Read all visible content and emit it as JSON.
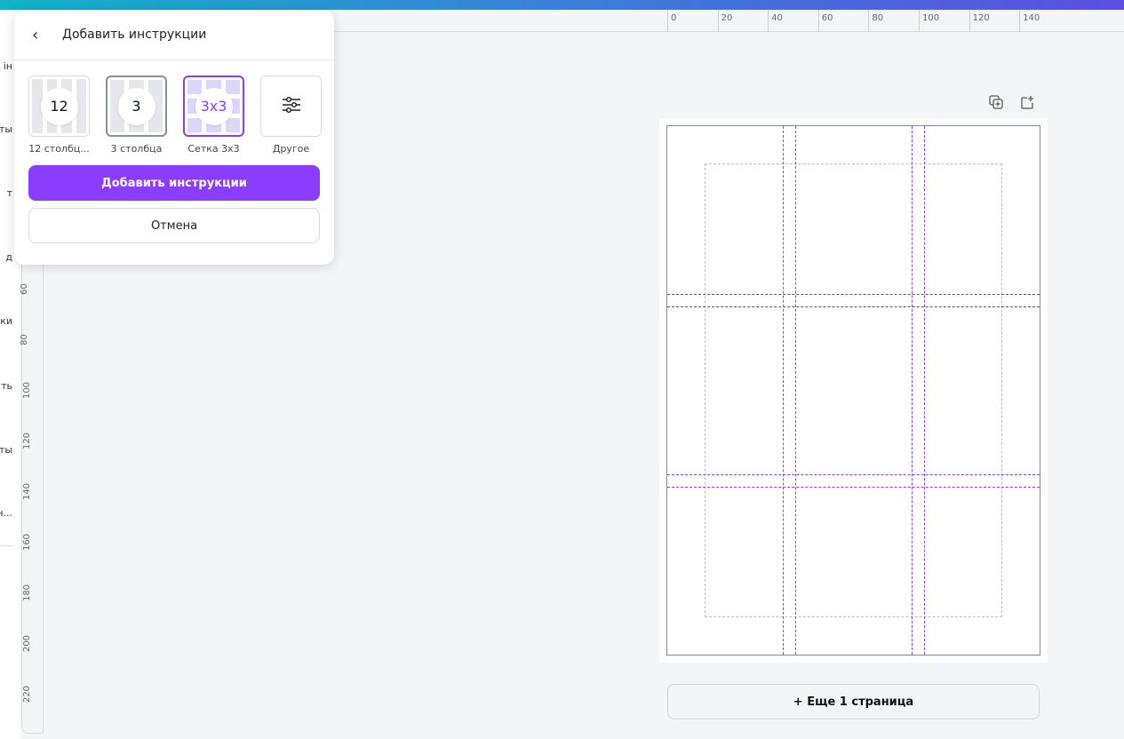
{
  "sidebar": {
    "labels": [
      "ін",
      "ты",
      "т",
      "д",
      "ки",
      "ть",
      "ты",
      "ен..."
    ]
  },
  "rulers": {
    "horizontal": [
      "0",
      "20",
      "40",
      "60",
      "80",
      "100",
      "120",
      "140"
    ],
    "vertical": [
      "60",
      "80",
      "100",
      "120",
      "140",
      "160",
      "180",
      "200",
      "220"
    ]
  },
  "popup": {
    "title": "Добавить инструкции",
    "options": [
      {
        "badge": "12",
        "label": "12 столбц..."
      },
      {
        "badge": "3",
        "label": "3 столбца"
      },
      {
        "badge": "3x3",
        "label": "Сетка 3x3"
      },
      {
        "badge": "",
        "label": "Другое"
      }
    ],
    "add_label": "Добавить инструкции",
    "cancel_label": "Отмена"
  },
  "canvas": {
    "add_page_label": "+ Еще 1 страница"
  },
  "colors": {
    "accent": "#8b3dff"
  }
}
